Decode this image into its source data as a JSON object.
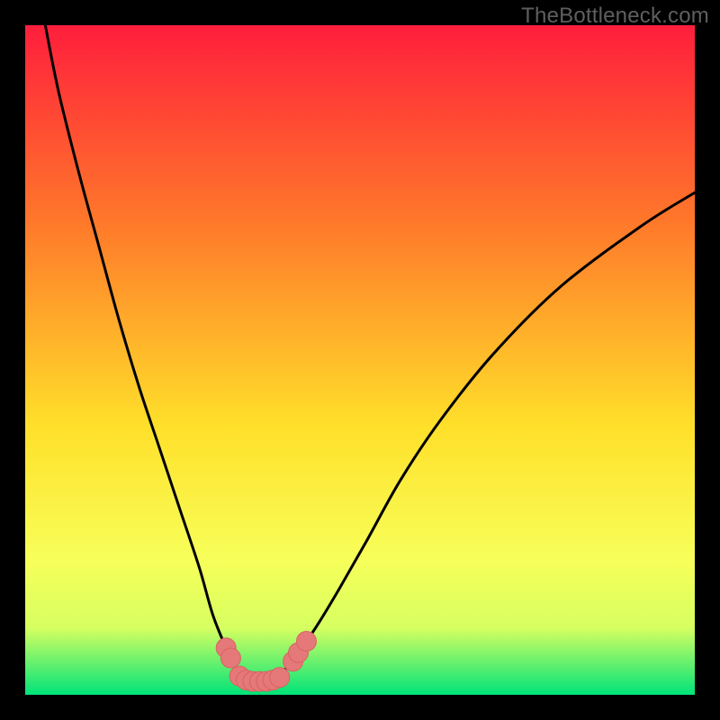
{
  "watermark": "TheBottleneck.com",
  "colors": {
    "bg_black": "#000000",
    "grad_top": "#ff1e3c",
    "grad_mid1": "#ff7a2a",
    "grad_mid2": "#ffe02a",
    "grad_low1": "#f7ff5a",
    "grad_low2": "#d6ff60",
    "grad_bottom": "#00e37a",
    "curve": "#000000",
    "marker_fill": "#e57878",
    "marker_stroke": "#d86363"
  },
  "chart_data": {
    "type": "line",
    "title": "",
    "xlabel": "",
    "ylabel": "",
    "xlim": [
      0,
      100
    ],
    "ylim": [
      0,
      100
    ],
    "series": [
      {
        "name": "bottleneck-curve",
        "x": [
          3,
          5,
          8,
          11,
          14,
          17,
          20,
          23,
          26,
          28,
          30,
          31,
          32,
          33,
          34,
          35,
          36,
          37,
          38,
          39,
          40,
          42,
          44,
          47,
          51,
          56,
          62,
          70,
          80,
          92,
          100
        ],
        "y": [
          100,
          90,
          78,
          67,
          56,
          46,
          37,
          28,
          19,
          12,
          7,
          5,
          3.5,
          2.5,
          2,
          2,
          2,
          2.5,
          3,
          4,
          5.5,
          8,
          11,
          16,
          23,
          32,
          41,
          51,
          61,
          70,
          75
        ]
      }
    ],
    "markers": [
      {
        "x": 30.0,
        "y": 7.0
      },
      {
        "x": 30.7,
        "y": 5.5
      },
      {
        "x": 32.0,
        "y": 2.8
      },
      {
        "x": 33.0,
        "y": 2.2
      },
      {
        "x": 34.0,
        "y": 2.0
      },
      {
        "x": 35.0,
        "y": 2.0
      },
      {
        "x": 36.0,
        "y": 2.0
      },
      {
        "x": 37.0,
        "y": 2.2
      },
      {
        "x": 38.0,
        "y": 2.6
      },
      {
        "x": 40.0,
        "y": 5.0
      },
      {
        "x": 40.8,
        "y": 6.3
      },
      {
        "x": 42.0,
        "y": 8.0
      }
    ],
    "gradient_stops": [
      {
        "offset": 0.0,
        "key": "grad_top"
      },
      {
        "offset": 0.3,
        "key": "grad_mid1"
      },
      {
        "offset": 0.6,
        "key": "grad_mid2"
      },
      {
        "offset": 0.8,
        "key": "grad_low1"
      },
      {
        "offset": 0.9,
        "key": "grad_low2"
      },
      {
        "offset": 1.0,
        "key": "grad_bottom"
      }
    ]
  }
}
